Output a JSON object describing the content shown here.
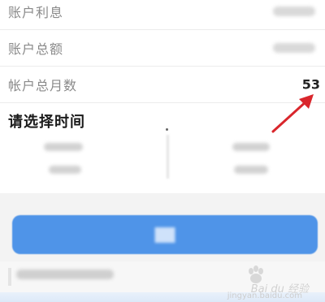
{
  "account": {
    "interest_label": "账户利息",
    "total_label": "账户总额",
    "months_label": "帐户总月数",
    "months_value": "53"
  },
  "time_picker": {
    "title": "请选择时间"
  },
  "colors": {
    "accent": "#4f94e8",
    "arrow": "#d9262c"
  },
  "watermark": {
    "text": "Bai du 经验",
    "url": "jingyan.baidu.com"
  }
}
